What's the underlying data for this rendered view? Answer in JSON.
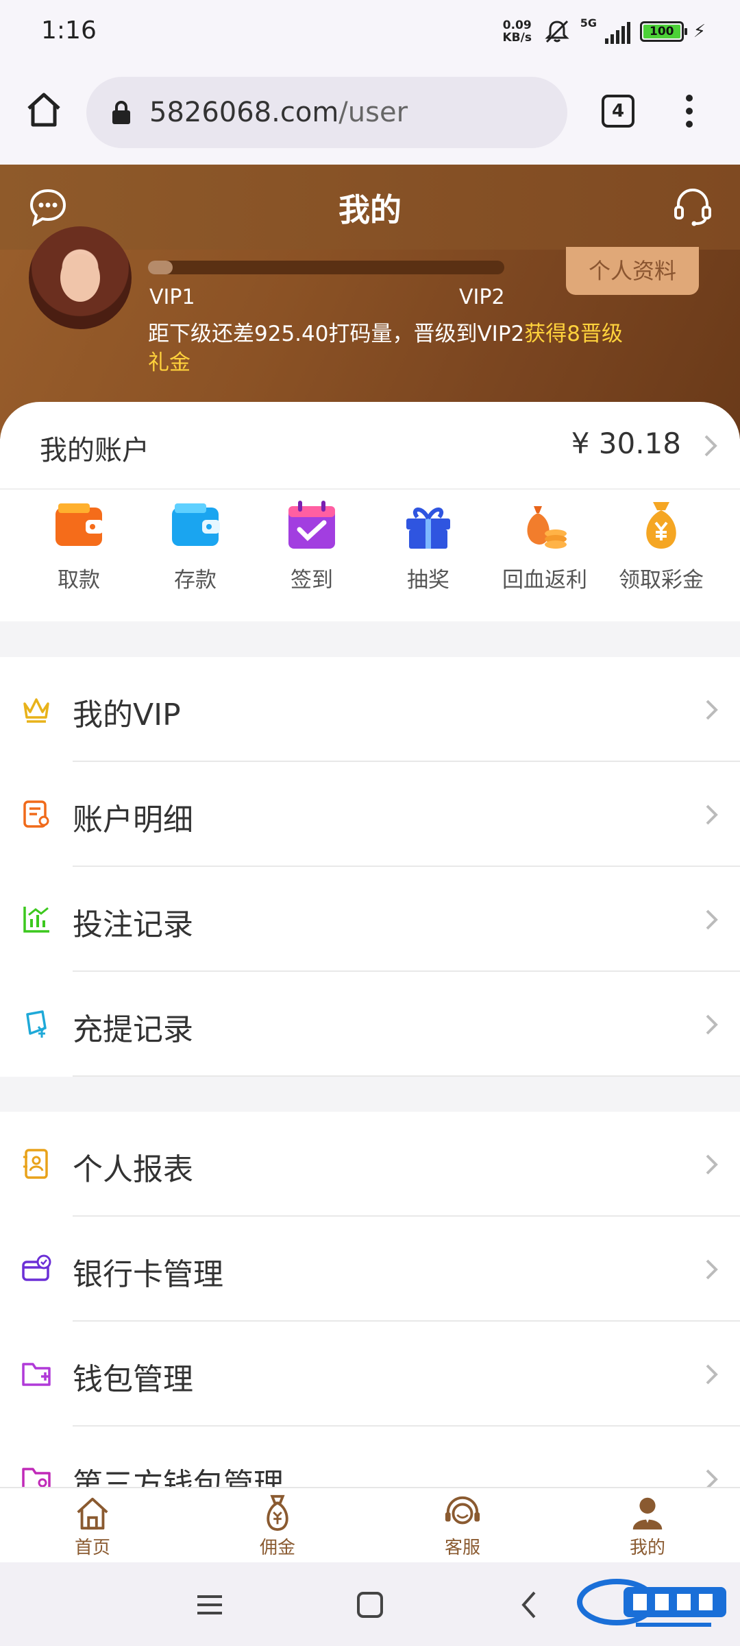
{
  "status_bar": {
    "time": "1:16",
    "net_speed_value": "0.09",
    "net_speed_unit": "KB/s",
    "network": "5G",
    "battery": "100",
    "icons": [
      "mute-icon",
      "signal-icon",
      "battery-icon",
      "charging-icon"
    ]
  },
  "browser": {
    "url_host": "5826068.com",
    "url_path": "/user",
    "tab_count": "4",
    "icons": [
      "home-icon",
      "lock-icon",
      "tabs-icon",
      "more-vert-icon"
    ]
  },
  "header": {
    "title": "我的",
    "left_icon": "chat-icon",
    "right_icon": "headset-icon"
  },
  "vip": {
    "current_level": "VIP1",
    "next_level": "VIP2",
    "progress_fraction": 0.07,
    "profile_button": "个人资料",
    "upgrade_text": "距下级还差925.40打码量，晋级到VIP2",
    "upgrade_reward": "获得8晋级礼金"
  },
  "account": {
    "label": "我的账户",
    "balance": "¥ 30.18"
  },
  "quick_actions": [
    {
      "label": "取款",
      "icon": "withdraw-wallet-icon",
      "color": "#f56c1a"
    },
    {
      "label": "存款",
      "icon": "deposit-wallet-icon",
      "color": "#1aa5f0"
    },
    {
      "label": "签到",
      "icon": "calendar-check-icon",
      "color": "#a23ee0"
    },
    {
      "label": "抽奖",
      "icon": "gift-icon",
      "color": "#2f55e0"
    },
    {
      "label": "回血返利",
      "icon": "money-bag-coins-icon",
      "color": "#f27d2c"
    },
    {
      "label": "领取彩金",
      "icon": "yuan-bag-icon",
      "color": "#f5a623"
    }
  ],
  "menu_group_1": [
    {
      "label": "我的VIP",
      "icon": "crown-icon",
      "color": "#e8b21a"
    },
    {
      "label": "账户明细",
      "icon": "account-detail-icon",
      "color": "#f06a1a"
    },
    {
      "label": "投注记录",
      "icon": "bar-chart-icon",
      "color": "#3cc81e"
    },
    {
      "label": "充提记录",
      "icon": "recharge-record-icon",
      "color": "#1fa9d8"
    }
  ],
  "menu_group_2": [
    {
      "label": "个人报表",
      "icon": "personal-report-icon",
      "color": "#e8a21a"
    },
    {
      "label": "银行卡管理",
      "icon": "bank-card-icon",
      "color": "#6b2fd6"
    },
    {
      "label": "钱包管理",
      "icon": "wallet-folder-icon",
      "color": "#b03ad8"
    },
    {
      "label": "第三方钱包管理",
      "icon": "third-party-wallet-icon",
      "color": "#c02ab8"
    }
  ],
  "tabbar": [
    {
      "label": "首页",
      "icon": "home-tab-icon"
    },
    {
      "label": "佣金",
      "icon": "commission-bag-icon"
    },
    {
      "label": "客服",
      "icon": "customer-service-icon"
    },
    {
      "label": "我的",
      "icon": "profile-tab-icon"
    }
  ],
  "colors": {
    "brand_brown": "#8b5225",
    "accent_gold": "#ffd23c",
    "tab_text": "#8a5a30"
  }
}
